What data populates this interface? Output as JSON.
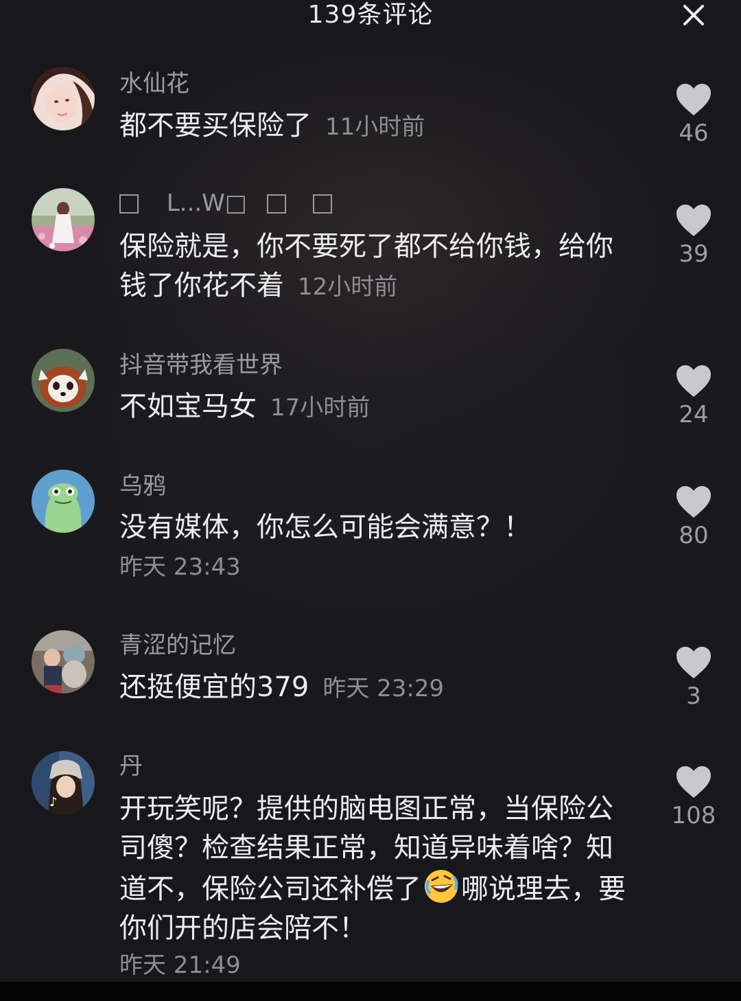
{
  "header": {
    "title": "139条评论",
    "close_icon": "close-icon"
  },
  "comments": [
    {
      "username": "水仙花",
      "text": "都不要买保险了",
      "time": "11小时前",
      "likes": "46"
    },
    {
      "username_parts": [
        "□",
        "L...W□",
        "□",
        "□"
      ],
      "text": "保险就是，你不要死了都不给你钱，给你钱了你花不着",
      "time": "12小时前",
      "likes": "39"
    },
    {
      "username": "抖音带我看世界",
      "text": "不如宝马女",
      "time": "17小时前",
      "likes": "24"
    },
    {
      "username": "乌鸦",
      "text": "没有媒体，你怎么可能会满意？！",
      "time": "昨天 23:43",
      "likes": "80"
    },
    {
      "username": "青涩的记忆",
      "text": "还挺便宜的379",
      "time": "昨天 23:29",
      "likes": "3"
    },
    {
      "username": "丹",
      "text_before_emoji": "开玩笑呢？提供的脑电图正常，当保险公司傻？检查结果正常，知道异味着啥？知道不，保险公司还补偿了",
      "emoji": "rolling-on-floor-laughing-emoji",
      "text_after_emoji": "哪说理去，要你们开的店会陪不！",
      "time": "昨天 21:49",
      "likes": "108"
    }
  ],
  "icons": {
    "like": "heart-icon",
    "avatar": "avatar"
  },
  "colors": {
    "background": "#18181c",
    "heart": "#c9c9cd",
    "text_primary": "#ededf0",
    "text_secondary": "#8d8d95"
  }
}
